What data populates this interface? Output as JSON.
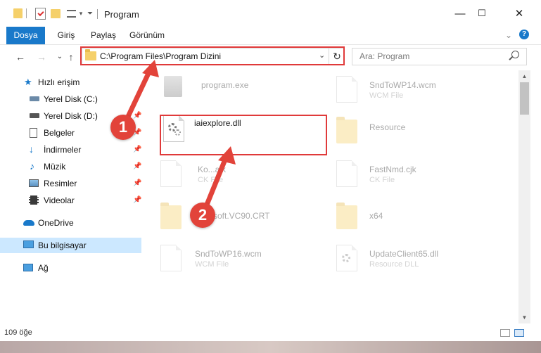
{
  "window": {
    "title": "Program",
    "controls": {
      "minimize": "—",
      "maximize": "☐",
      "close": "✕"
    }
  },
  "ribbon": {
    "tabs": [
      {
        "label": "Dosya",
        "active": true
      },
      {
        "label": "Giriş"
      },
      {
        "label": "Paylaş"
      },
      {
        "label": "Görünüm"
      }
    ],
    "expand_glyph": "⌄",
    "help_glyph": "?"
  },
  "address_bar": {
    "path": "C:\\Program Files\\Program Dizini",
    "dropdown_glyph": "⌄",
    "refresh_glyph": "↻"
  },
  "nav_buttons": {
    "back": "←",
    "forward": "→",
    "recent": "⌄",
    "up": "↑"
  },
  "search": {
    "placeholder": "Ara: Program"
  },
  "nav_pane": {
    "items": [
      {
        "label": "Hızlı erişim",
        "icon": "star-icon"
      },
      {
        "label": "Yerel Disk (C:)",
        "icon": "drive-icon",
        "pinned": true
      },
      {
        "label": "Yerel Disk (D:)",
        "icon": "drive-icon",
        "pinned": true
      },
      {
        "label": "Belgeler",
        "icon": "documents-icon",
        "pinned": true
      },
      {
        "label": "İndirmeler",
        "icon": "download-icon",
        "pinned": true
      },
      {
        "label": "Müzik",
        "icon": "music-icon",
        "pinned": true
      },
      {
        "label": "Resimler",
        "icon": "pictures-icon",
        "pinned": true
      },
      {
        "label": "Videolar",
        "icon": "videos-icon",
        "pinned": true
      },
      {
        "label": "OneDrive",
        "icon": "cloud-icon"
      },
      {
        "label": "Bu bilgisayar",
        "icon": "computer-icon",
        "selected": true
      },
      {
        "label": "Ağ",
        "icon": "network-icon"
      }
    ]
  },
  "files": {
    "left": [
      {
        "name": "program.exe",
        "type": "",
        "icon": "exe-icon",
        "faded": true
      },
      {
        "name": "iaiexplore.dll",
        "type": "",
        "icon": "dll-gear-icon",
        "faded": false,
        "highlighted": true
      },
      {
        "name": "Ko...ajk",
        "type": "CK File",
        "icon": "document-icon",
        "faded": true
      },
      {
        "name": "...soft.VC90.CRT",
        "type": "",
        "icon": "folder-icon",
        "faded": true
      },
      {
        "name": "SndToWP16.wcm",
        "type": "WCM File",
        "icon": "document-icon",
        "faded": true
      }
    ],
    "right": [
      {
        "name": "SndToWP14.wcm",
        "type": "WCM File",
        "icon": "document-icon"
      },
      {
        "name": "Resource",
        "type": "",
        "icon": "folder-icon"
      },
      {
        "name": "FastNmd.cjk",
        "type": "CK File",
        "icon": "document-icon"
      },
      {
        "name": "x64",
        "type": "",
        "icon": "folder-icon"
      },
      {
        "name": "UpdateClient65.dll",
        "type": "Resource DLL",
        "icon": "dll-gear-icon"
      }
    ]
  },
  "status": {
    "count": "109 öğe"
  },
  "callouts": [
    {
      "number": "1",
      "color": "#e2433a"
    },
    {
      "number": "2",
      "color": "#e2433a"
    }
  ],
  "colors": {
    "accent": "#1979ca",
    "highlight": "#e03a3a",
    "selection": "#cce8ff"
  }
}
